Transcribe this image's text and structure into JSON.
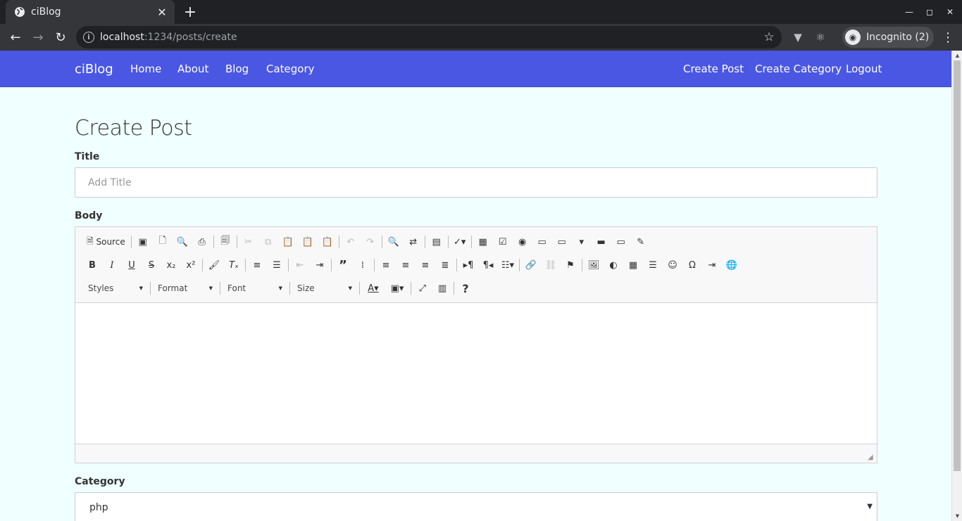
{
  "browser": {
    "tab_title": "ciBlog",
    "url_host": "localhost",
    "url_rest": ":1234/posts/create",
    "profile_label": "Incognito (2)"
  },
  "navbar": {
    "brand": "ciBlog",
    "left_links": [
      "Home",
      "About",
      "Blog",
      "Category"
    ],
    "right_links": [
      "Create Post",
      "Create Category",
      "Logout"
    ],
    "bg_color": "#4a57e3"
  },
  "page": {
    "heading": "Create Post",
    "title_label": "Title",
    "title_placeholder": "Add Title",
    "body_label": "Body",
    "category_label": "Category",
    "category_value": "php",
    "bg_color": "#f0ffff"
  },
  "editor": {
    "source_label": "Source",
    "combos": [
      "Styles",
      "Format",
      "Font",
      "Size"
    ]
  }
}
